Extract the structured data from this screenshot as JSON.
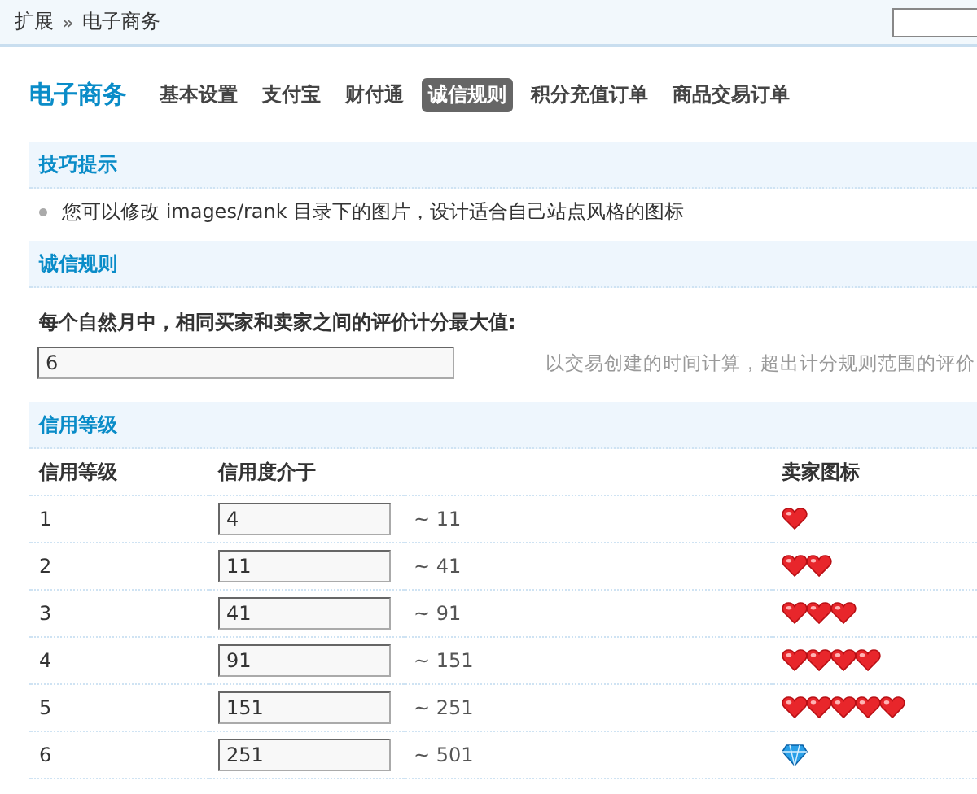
{
  "breadcrumb": {
    "items": [
      "扩展",
      "电子商务"
    ],
    "separator": "»"
  },
  "title": "电子商务",
  "tabs": [
    {
      "label": "基本设置",
      "selected": false
    },
    {
      "label": "支付宝",
      "selected": false
    },
    {
      "label": "财付通",
      "selected": false
    },
    {
      "label": "诚信规则",
      "selected": true
    },
    {
      "label": "积分充值订单",
      "selected": false
    },
    {
      "label": "商品交易订单",
      "selected": false
    }
  ],
  "tips": {
    "heading": "技巧提示",
    "items": [
      "您可以修改 images/rank 目录下的图片，设计适合自己站点风格的图标"
    ]
  },
  "rules": {
    "heading": "诚信规则",
    "label": "每个自然月中，相同买家和卖家之间的评价计分最大值:",
    "value": "6",
    "hint": "以交易创建的时间计算，超出计分规则范围的评价"
  },
  "levels": {
    "heading": "信用等级",
    "columns": [
      "信用等级",
      "信用度介于",
      "卖家图标"
    ],
    "rows": [
      {
        "level": "1",
        "from": "4",
        "to": "~ 11",
        "icons": [
          {
            "kind": "heart"
          }
        ]
      },
      {
        "level": "2",
        "from": "11",
        "to": "~ 41",
        "icons": [
          {
            "kind": "heart"
          },
          {
            "kind": "heart"
          }
        ]
      },
      {
        "level": "3",
        "from": "41",
        "to": "~ 91",
        "icons": [
          {
            "kind": "heart"
          },
          {
            "kind": "heart"
          },
          {
            "kind": "heart"
          }
        ]
      },
      {
        "level": "4",
        "from": "91",
        "to": "~ 151",
        "icons": [
          {
            "kind": "heart"
          },
          {
            "kind": "heart"
          },
          {
            "kind": "heart"
          },
          {
            "kind": "heart"
          }
        ]
      },
      {
        "level": "5",
        "from": "151",
        "to": "~ 251",
        "icons": [
          {
            "kind": "heart"
          },
          {
            "kind": "heart"
          },
          {
            "kind": "heart"
          },
          {
            "kind": "heart"
          },
          {
            "kind": "heart"
          }
        ]
      },
      {
        "level": "6",
        "from": "251",
        "to": "~ 501",
        "icons": [
          {
            "kind": "diamond"
          }
        ]
      }
    ]
  }
}
